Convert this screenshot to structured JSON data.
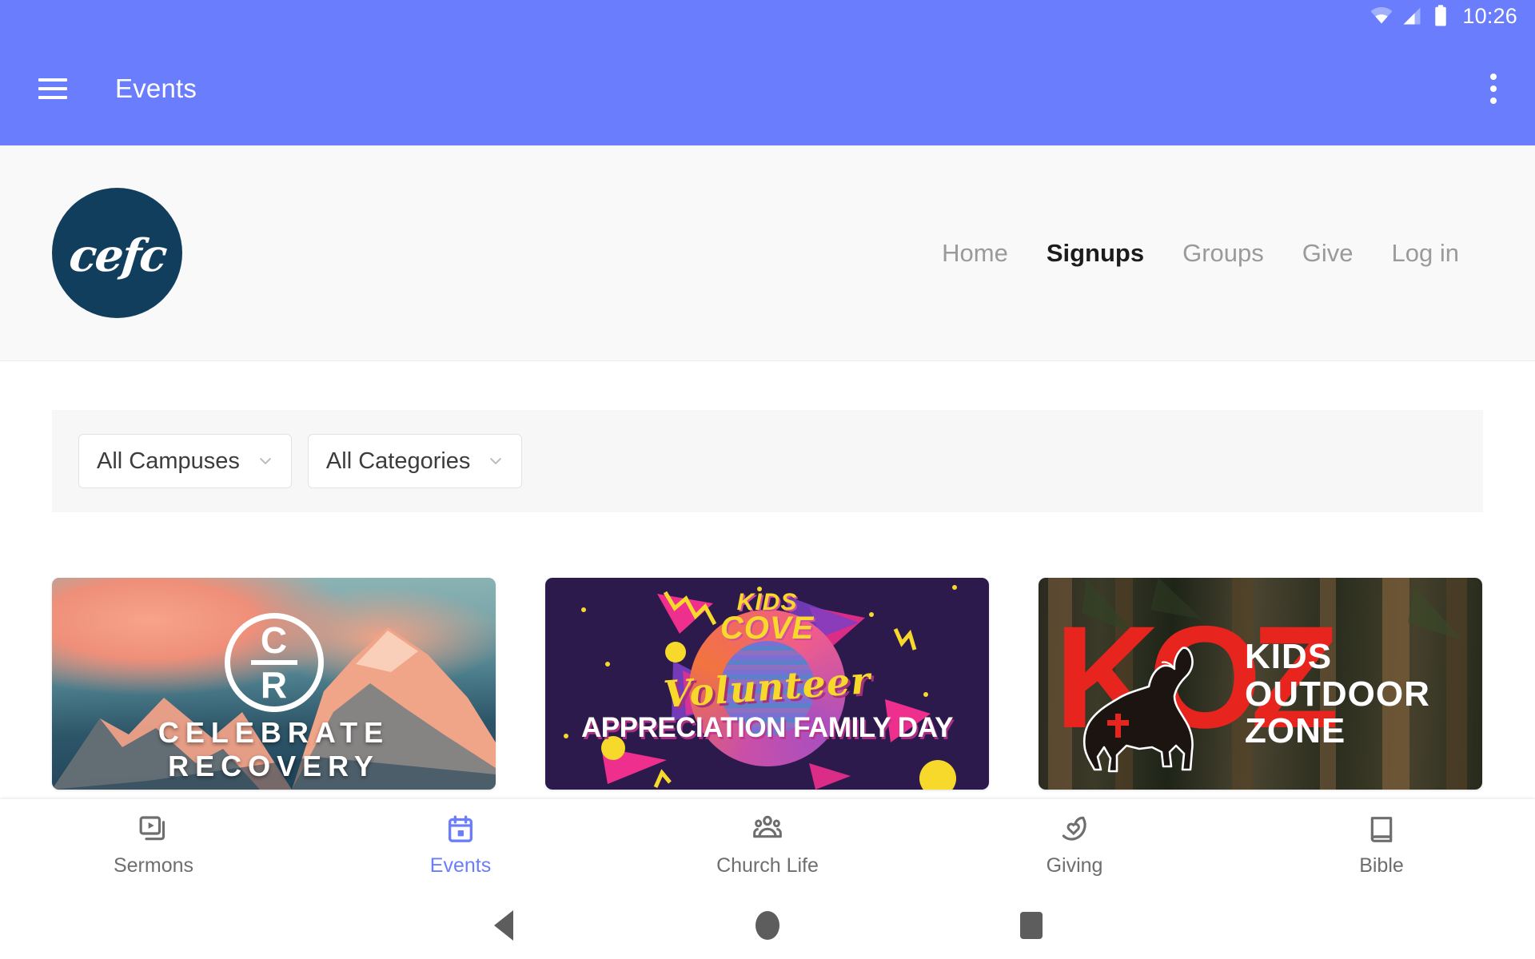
{
  "status_bar": {
    "time": "10:26",
    "icons": [
      "wifi-icon",
      "cellular-signal-icon",
      "battery-icon"
    ]
  },
  "app_bar": {
    "menu_icon": "hamburger-menu-icon",
    "title": "Events",
    "overflow_icon": "overflow-menu-icon",
    "background_color": "#6a7dfc"
  },
  "web_header": {
    "logo_text": "cefc",
    "logo_background": "#123e5e",
    "nav": [
      {
        "label": "Home",
        "active": false
      },
      {
        "label": "Signups",
        "active": true
      },
      {
        "label": "Groups",
        "active": false
      },
      {
        "label": "Give",
        "active": false
      },
      {
        "label": "Log in",
        "active": false
      }
    ]
  },
  "filters": [
    {
      "label": "All Campuses",
      "icon": "chevron-down-icon"
    },
    {
      "label": "All Categories",
      "icon": "chevron-down-icon"
    }
  ],
  "event_cards": [
    {
      "id": "celebrate-recovery",
      "title": "CELEBRATE RECOVERY",
      "logo_letters": [
        "C",
        "R"
      ],
      "image_description": "snow-capped mountain at sunset"
    },
    {
      "id": "kids-cove-volunteer-appreciation",
      "kicker_line1": "KIDS",
      "kicker_line2": "COVE",
      "script_word": "Volunteer",
      "title": "APPRECIATION FAMILY DAY",
      "image_description": "retro 80s neon graphic on dark purple"
    },
    {
      "id": "kids-outdoor-zone",
      "monogram": "KOZ",
      "title_line1": "KIDS",
      "title_line2": "OUTDOOR",
      "title_line3": "ZONE",
      "image_description": "howling wolf silhouette over forest"
    }
  ],
  "tab_bar": {
    "accent_color": "#6a7dfc",
    "tabs": [
      {
        "label": "Sermons",
        "icon": "video-library-icon",
        "active": false
      },
      {
        "label": "Events",
        "icon": "calendar-icon",
        "active": true
      },
      {
        "label": "Church Life",
        "icon": "people-group-icon",
        "active": false
      },
      {
        "label": "Giving",
        "icon": "hand-heart-icon",
        "active": false
      },
      {
        "label": "Bible",
        "icon": "book-icon",
        "active": false
      }
    ]
  },
  "system_nav": {
    "back": "back-triangle-icon",
    "home": "home-circle-icon",
    "recents": "recents-square-icon"
  }
}
